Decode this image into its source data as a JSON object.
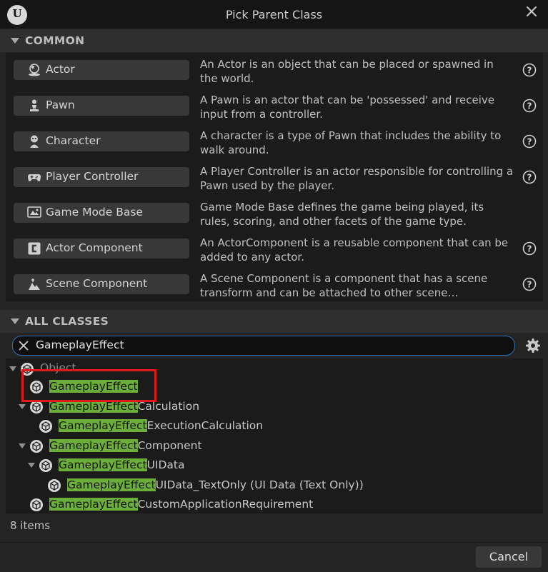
{
  "window": {
    "title": "Pick Parent Class"
  },
  "common": {
    "header": "COMMON",
    "items": [
      {
        "label": "Actor",
        "icon": "actor-icon",
        "description": "An Actor is an object that can be placed or spawned in the world."
      },
      {
        "label": "Pawn",
        "icon": "pawn-icon",
        "description": "A Pawn is an actor that can be 'possessed' and receive input from a controller."
      },
      {
        "label": "Character",
        "icon": "character-icon",
        "description": "A character is a type of Pawn that includes the ability to walk around."
      },
      {
        "label": "Player Controller",
        "icon": "gamepad-icon",
        "description": "A Player Controller is an actor responsible for controlling a Pawn used by the player."
      },
      {
        "label": "Game Mode Base",
        "icon": "game-mode-icon",
        "description": "Game Mode Base defines the game being played, its rules, scoring, and other facets of the game type."
      },
      {
        "label": "Actor Component",
        "icon": "actor-component-icon",
        "description": "An ActorComponent is a reusable component that can be added to any actor."
      },
      {
        "label": "Scene Component",
        "icon": "scene-component-icon",
        "description": "A Scene Component is a component that has a scene transform and can be attached to other scene…"
      }
    ]
  },
  "all_classes": {
    "header": "ALL CLASSES",
    "search": {
      "value": "GameplayEffect",
      "highlight_color": "#6cae3a"
    },
    "tree": [
      {
        "match": "",
        "rest": "Object"
      },
      {
        "match": "GameplayEffect",
        "rest": ""
      },
      {
        "match": "GameplayEffect",
        "rest": "Calculation"
      },
      {
        "match": "GameplayEffect",
        "rest": "ExecutionCalculation"
      },
      {
        "match": "GameplayEffect",
        "rest": "Component"
      },
      {
        "match": "GameplayEffect",
        "rest": "UIData"
      },
      {
        "match": "GameplayEffect",
        "rest": "UIData_TextOnly (UI Data (Text Only))"
      },
      {
        "match": "GameplayEffect",
        "rest": "CustomApplicationRequirement"
      }
    ],
    "item_count": "8 items"
  },
  "footer": {
    "cancel_label": "Cancel"
  },
  "colors": {
    "accent_blue": "#2e74b8",
    "annotation_red": "#e01a1a",
    "match_green": "#6cae3a"
  }
}
